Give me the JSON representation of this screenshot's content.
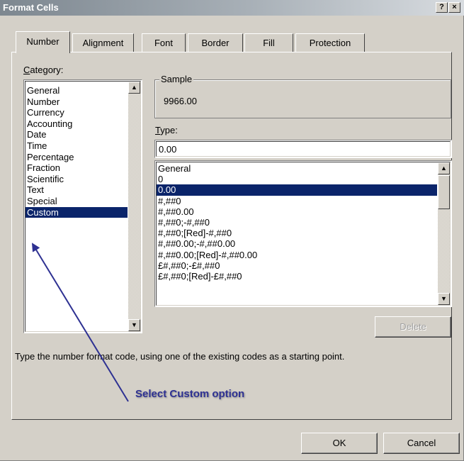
{
  "window": {
    "title": "Format Cells",
    "help_glyph": "?",
    "close_glyph": "×"
  },
  "tabs": [
    {
      "label": "Number",
      "active": true
    },
    {
      "label": "Alignment",
      "active": false
    },
    {
      "label": "Font",
      "active": false
    },
    {
      "label": "Border",
      "active": false
    },
    {
      "label": "Fill",
      "active": false
    },
    {
      "label": "Protection",
      "active": false
    }
  ],
  "category": {
    "label_first": "C",
    "label_rest": "ategory:",
    "items": [
      "General",
      "Number",
      "Currency",
      "Accounting",
      "Date",
      "Time",
      "Percentage",
      "Fraction",
      "Scientific",
      "Text",
      "Special",
      "Custom"
    ],
    "selected": "Custom"
  },
  "sample": {
    "legend": "Sample",
    "value": "9966.00"
  },
  "type": {
    "label_first": "T",
    "label_rest": "ype:",
    "value": "0.00",
    "codes": [
      "General",
      "0",
      "0.00",
      "#,##0",
      "#,##0.00",
      "#,##0;-#,##0",
      "#,##0;[Red]-#,##0",
      "#,##0.00;-#,##0.00",
      "#,##0.00;[Red]-#,##0.00",
      "£#,##0;-£#,##0",
      "£#,##0;[Red]-£#,##0"
    ],
    "selected": "0.00"
  },
  "buttons": {
    "delete": "Delete",
    "ok": "OK",
    "cancel": "Cancel"
  },
  "hint": "Type the number format code, using one of the existing codes as a starting point.",
  "annotation": {
    "text": "Select Custom option",
    "color": "#2e3192"
  },
  "icons": {
    "scroll_up": "▲",
    "scroll_down": "▼"
  }
}
